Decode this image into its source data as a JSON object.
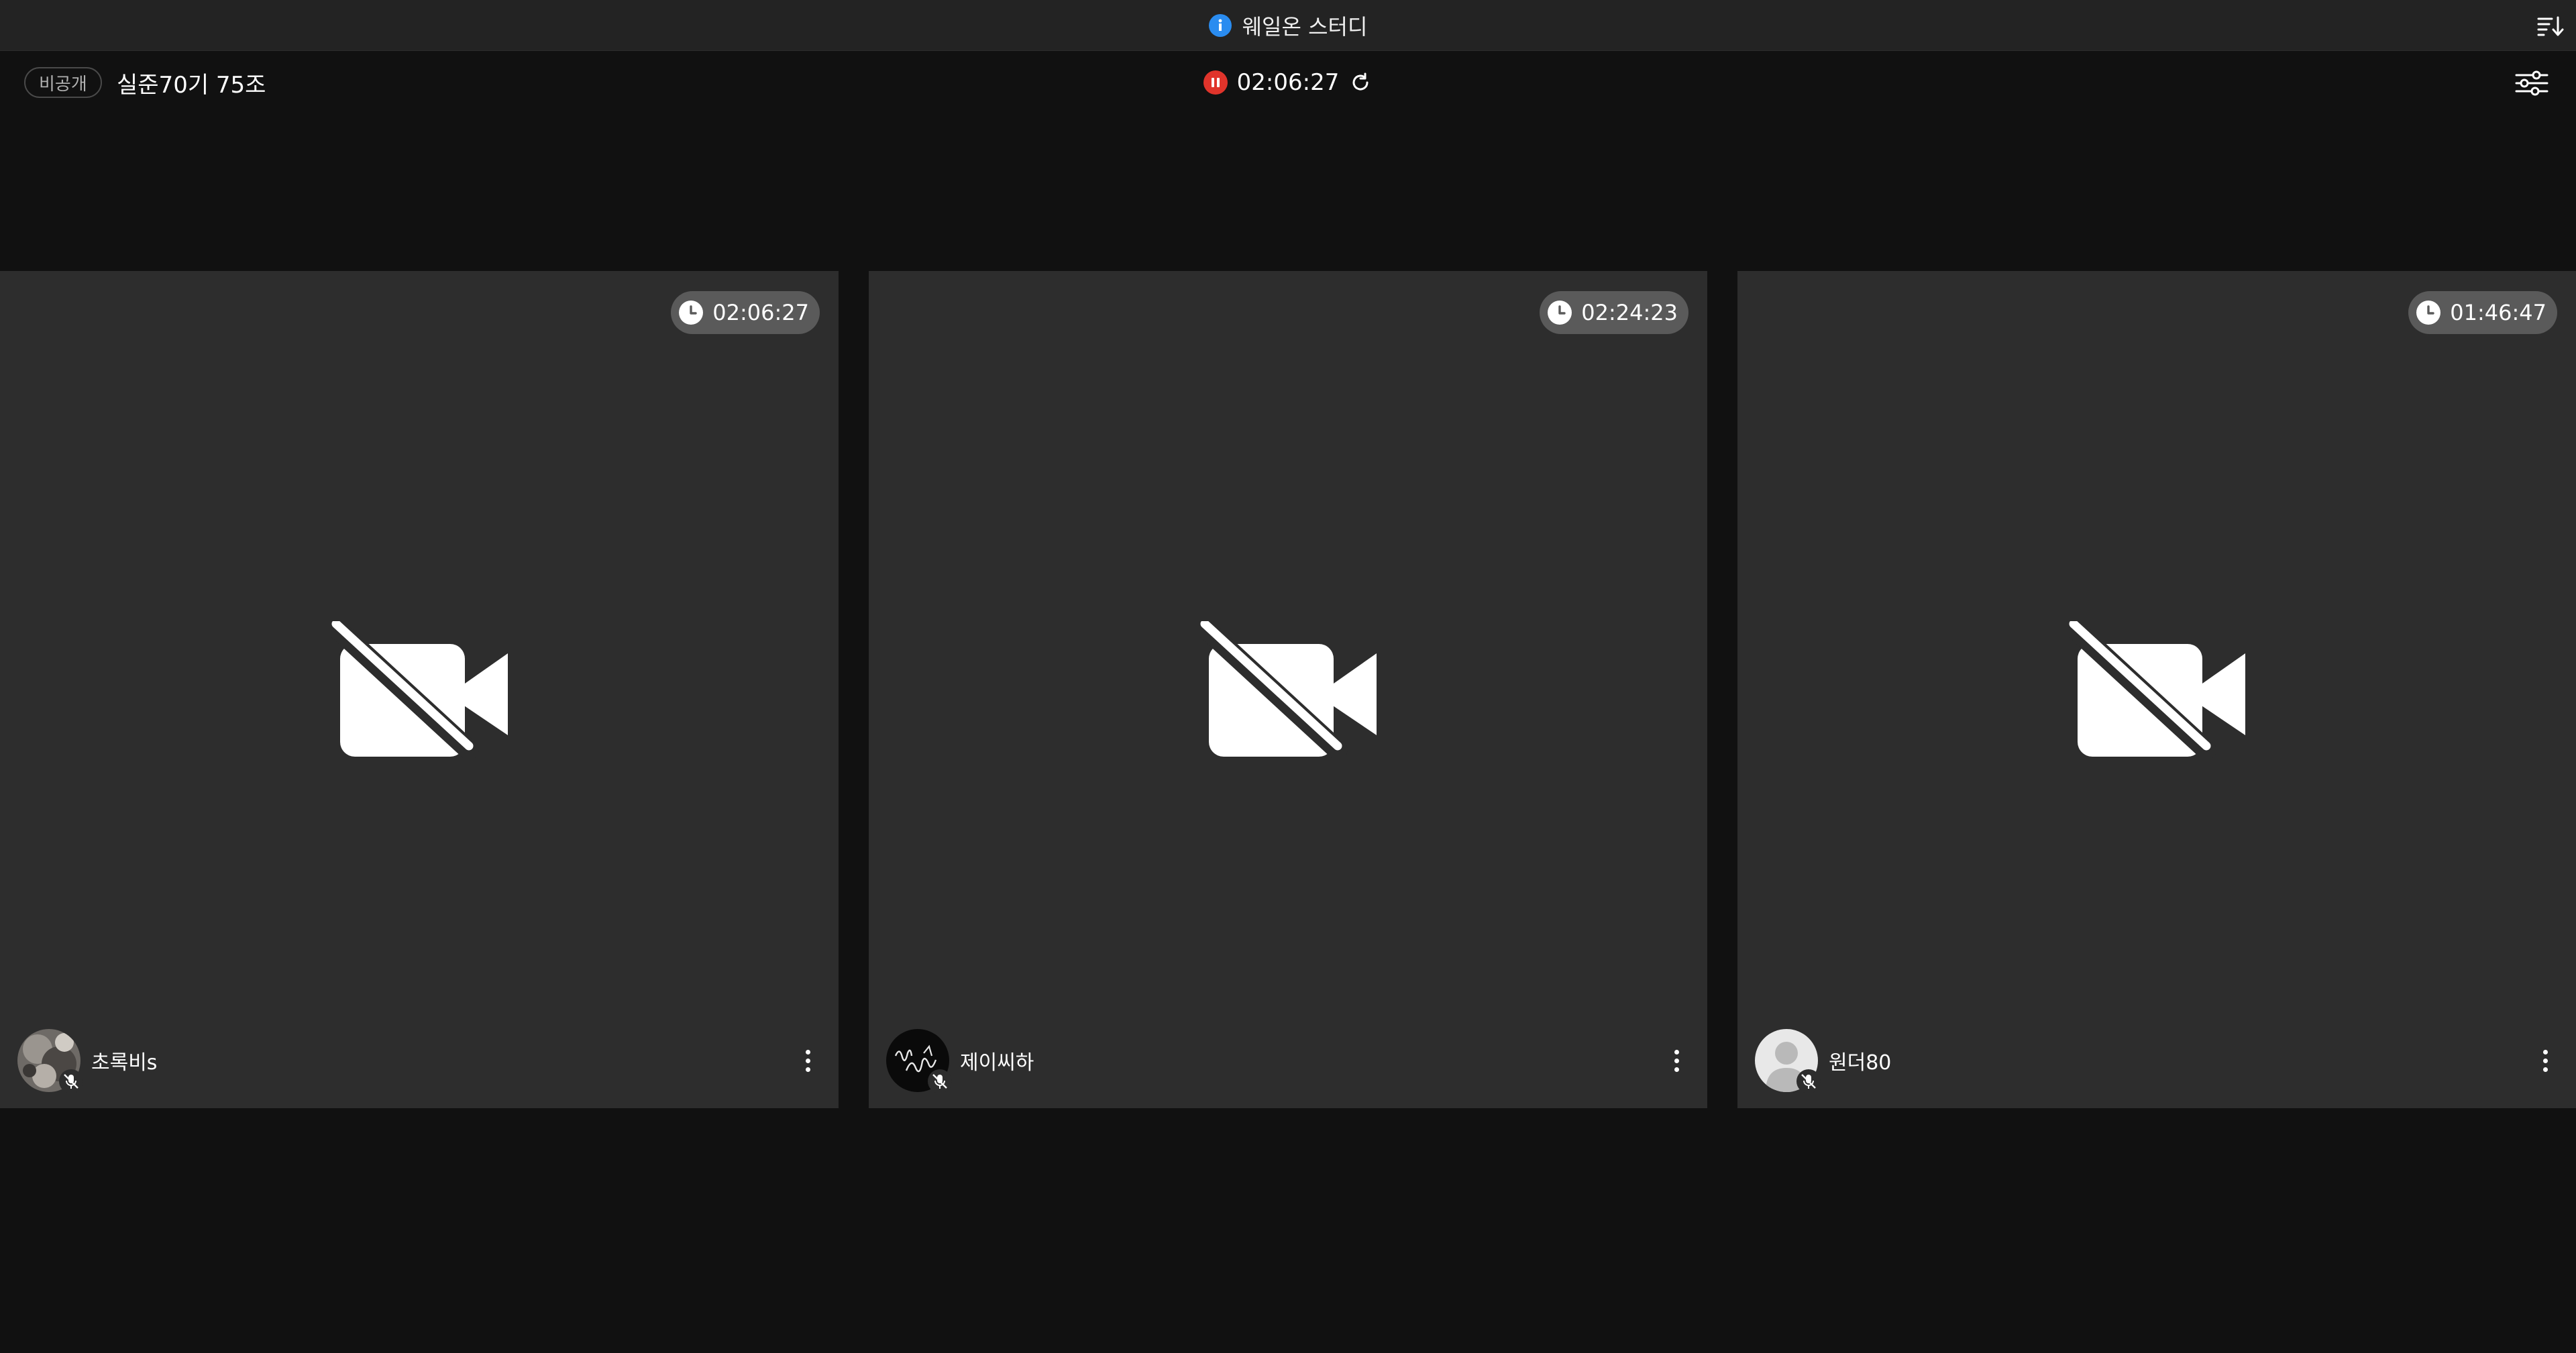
{
  "window": {
    "title": "웨일온 스터디",
    "info_icon": "info-icon",
    "sort_icon": "sort-icon"
  },
  "room": {
    "privacy_badge": "비공개",
    "name": "실준70기 75조",
    "timer": "02:06:27",
    "timer_state_icon": "pause-icon",
    "refresh_icon": "refresh-icon",
    "settings_icon": "settings-sliders-icon"
  },
  "colors": {
    "background": "#111111",
    "titlebar": "#232323",
    "tile": "#2d2d2d",
    "timer_pill": "#5a5a5a",
    "accent_blue": "#2a8cf0",
    "recording_red": "#e0342b"
  },
  "participants": [
    {
      "name": "초록비s",
      "study_time": "02:06:27",
      "camera": "off",
      "mic": "off",
      "avatar": "photo-avatar"
    },
    {
      "name": "제이씨하",
      "study_time": "02:24:23",
      "camera": "off",
      "mic": "off",
      "avatar": "signature-avatar"
    },
    {
      "name": "원더80",
      "study_time": "01:46:47",
      "camera": "off",
      "mic": "off",
      "avatar": "default-avatar"
    }
  ]
}
